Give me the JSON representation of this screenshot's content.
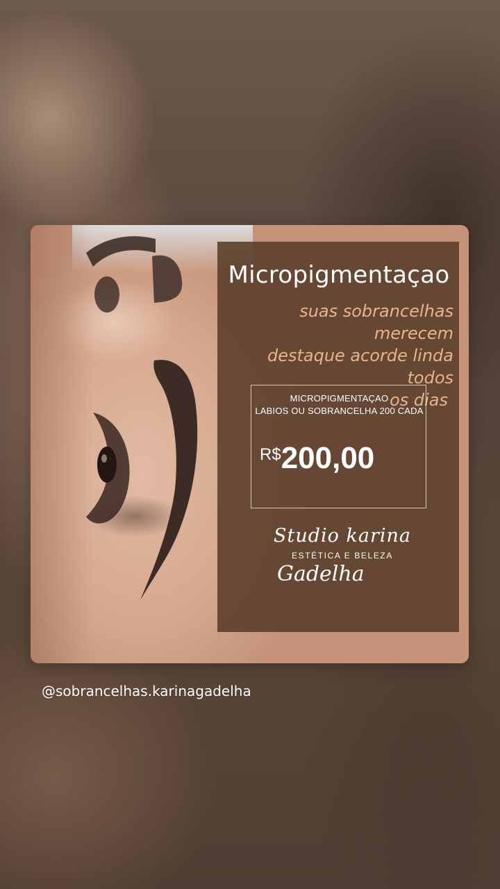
{
  "post": {
    "title": "Micropigmentaçao",
    "subtitle_lines": [
      "suas sobrancelhas merecem",
      "destaque acorde linda todos",
      "os dias"
    ],
    "price_box": {
      "line1": "MICROPIGMENTAÇAO",
      "line2": "LABIOS OU SOBRANCELHA 200 CADA",
      "currency": "R$",
      "amount": "200,00"
    },
    "brand": {
      "line1": "Studio karina",
      "line2": "ESTÉTICA E BELEZA",
      "line3": "Gadelha"
    }
  },
  "handle": "@sobrancelhas.karinagadelha",
  "colors": {
    "panel": "#563a28",
    "subtitle": "#e7b48d",
    "text": "#ffffff"
  }
}
